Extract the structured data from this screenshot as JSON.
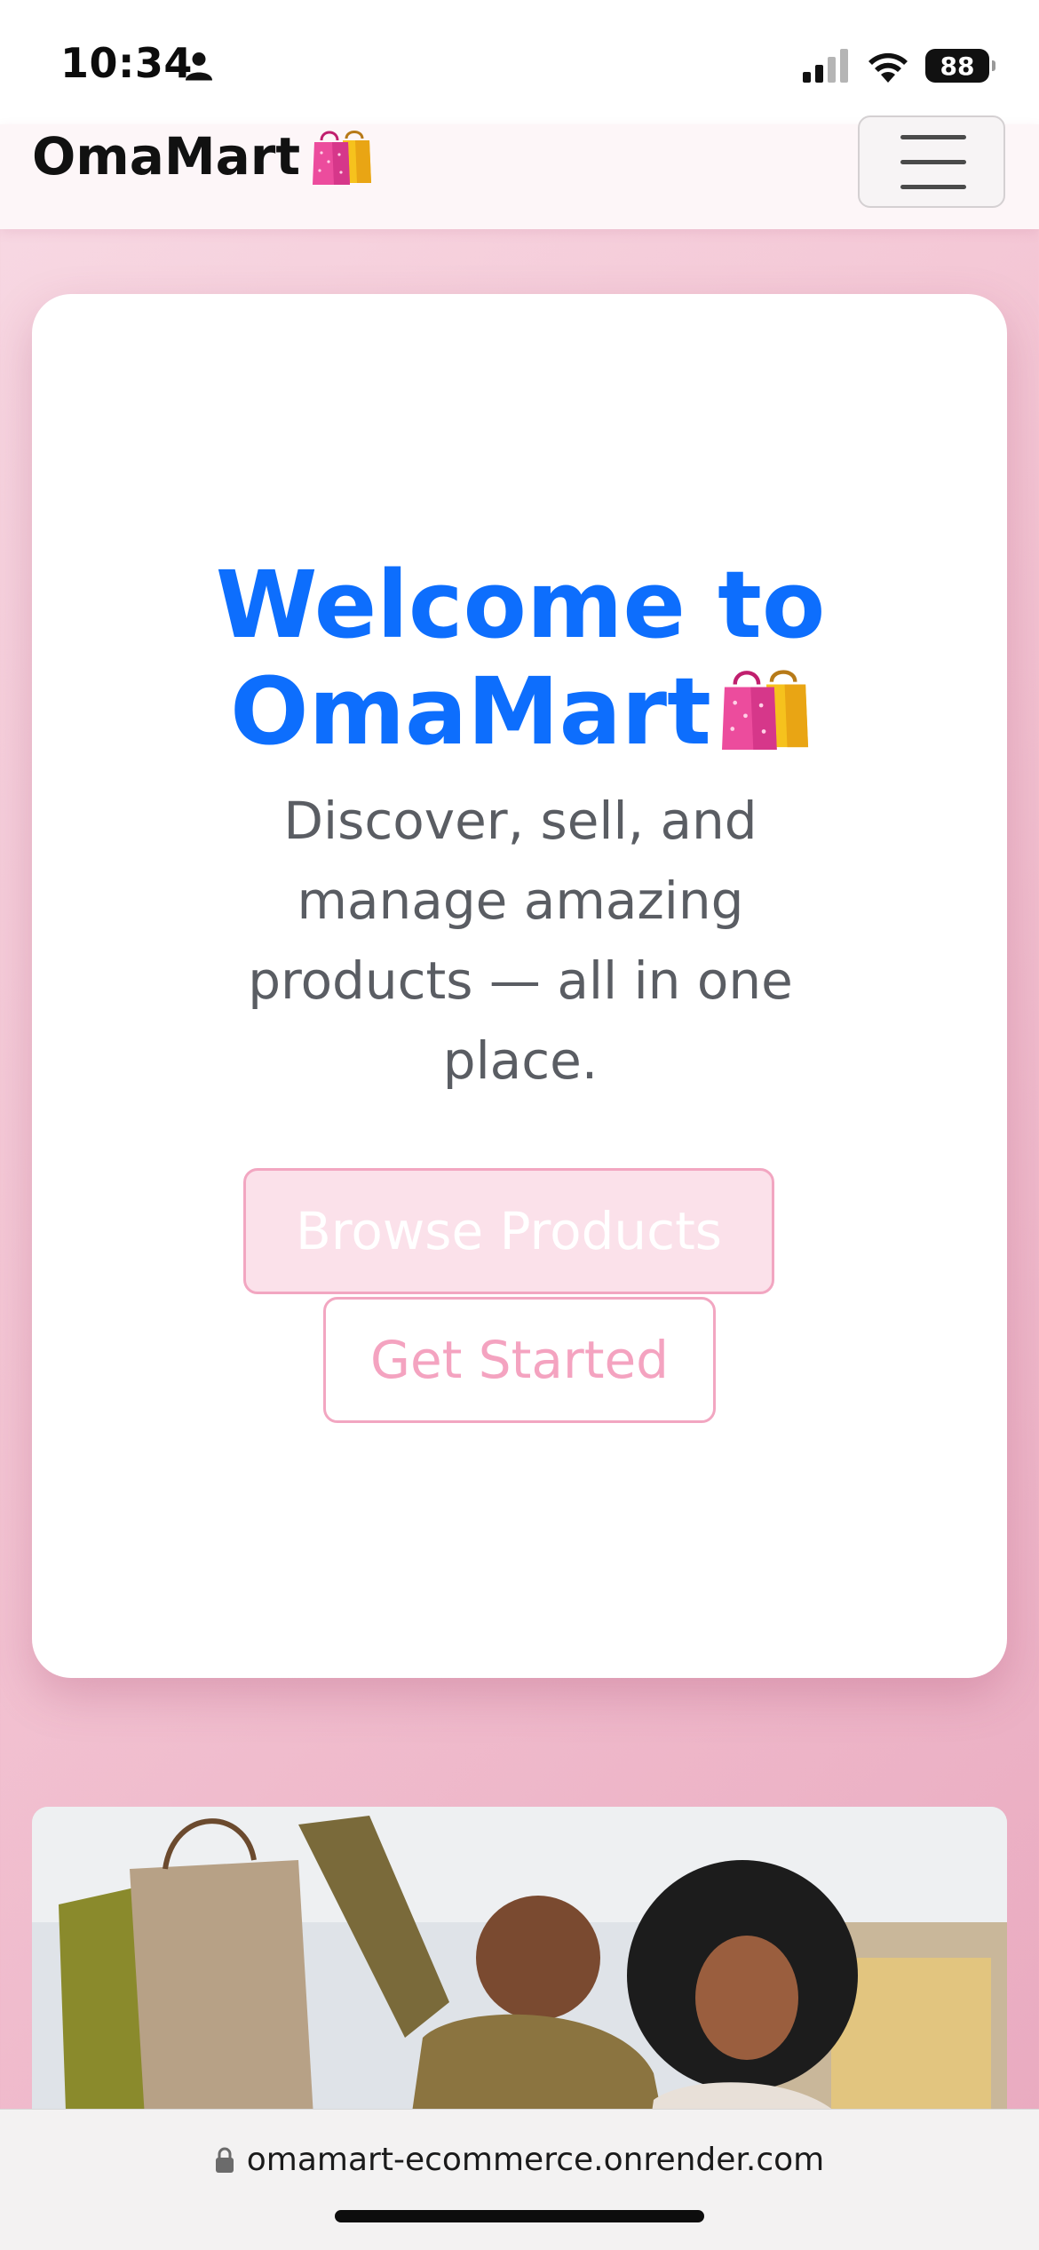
{
  "status_bar": {
    "time": "10:34",
    "battery": "88",
    "icons": [
      "person-icon",
      "cellular-signal-icon",
      "wifi-icon",
      "battery-icon"
    ]
  },
  "navbar": {
    "brand": "OmaMart",
    "brand_icon": "shopping-bags-icon",
    "menu_icon": "hamburger-menu-icon"
  },
  "hero": {
    "title_line1": "Welcome to",
    "title_line2": "OmaMart",
    "title_icon": "shopping-bags-icon",
    "subtitle": "Discover, sell, and manage amazing products — all in one place.",
    "primary_button": "Browse Products",
    "secondary_button": "Get Started"
  },
  "image_card": {
    "description_icon": "photo-shoppers-icon"
  },
  "browser": {
    "url": "omamart-ecommerce.onrender.com",
    "lock_icon": "lock-icon"
  },
  "colors": {
    "accent": "#0d6efd",
    "pink": "#f2a6c1",
    "background": "#f3c4d3"
  }
}
